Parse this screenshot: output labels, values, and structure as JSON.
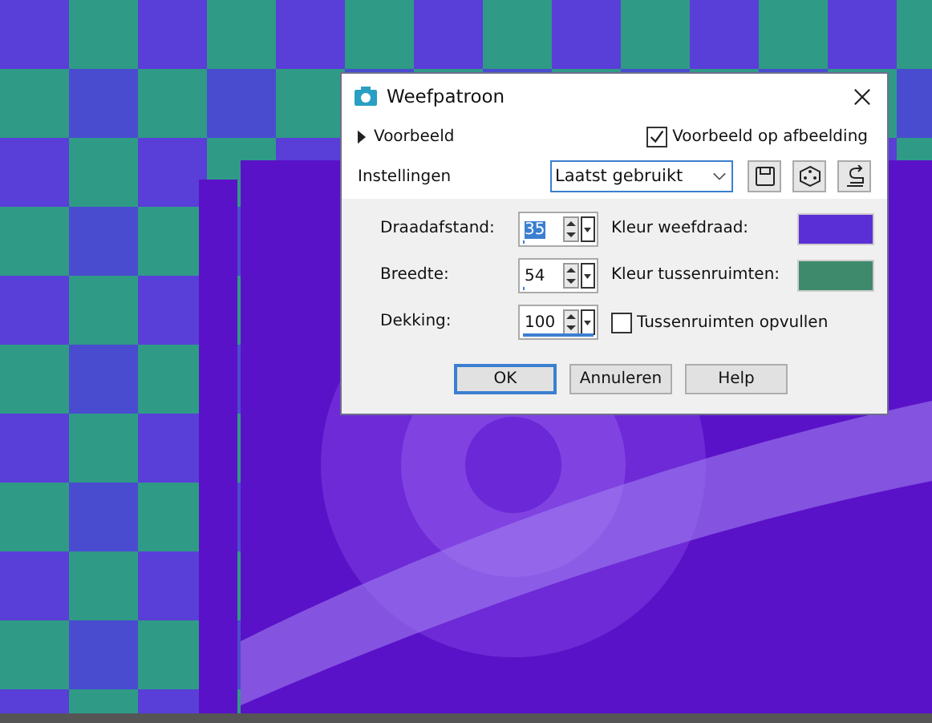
{
  "dialog": {
    "title": "Weefpatroon",
    "preview_toggle": {
      "label": "Voorbeeld",
      "expanded": false
    },
    "preview_on_image": {
      "label": "Voorbeeld op afbeelding",
      "checked": true
    },
    "presets": {
      "label": "Instellingen",
      "value": "Laatst gebruikt"
    },
    "fields": [
      {
        "label": "Draadafstand:",
        "value": "35",
        "selected": true,
        "level": 0.02
      },
      {
        "label": "Breedte:",
        "value": "54",
        "selected": false,
        "level": 0.03
      },
      {
        "label": "Dekking:",
        "value": "100",
        "selected": false,
        "level": 1
      }
    ],
    "colors": [
      {
        "label": "Kleur weefdraad:",
        "color": "#5b2fd6"
      },
      {
        "label": "Kleur tussenruimten:",
        "color": "#3d8a6c"
      }
    ],
    "fill_gaps": {
      "label": "Tussenruimten opvullen",
      "checked": false
    },
    "buttons": [
      {
        "label": "OK",
        "default": true
      },
      {
        "label": "Annuleren",
        "default": false
      },
      {
        "label": "Help",
        "default": false
      }
    ]
  }
}
